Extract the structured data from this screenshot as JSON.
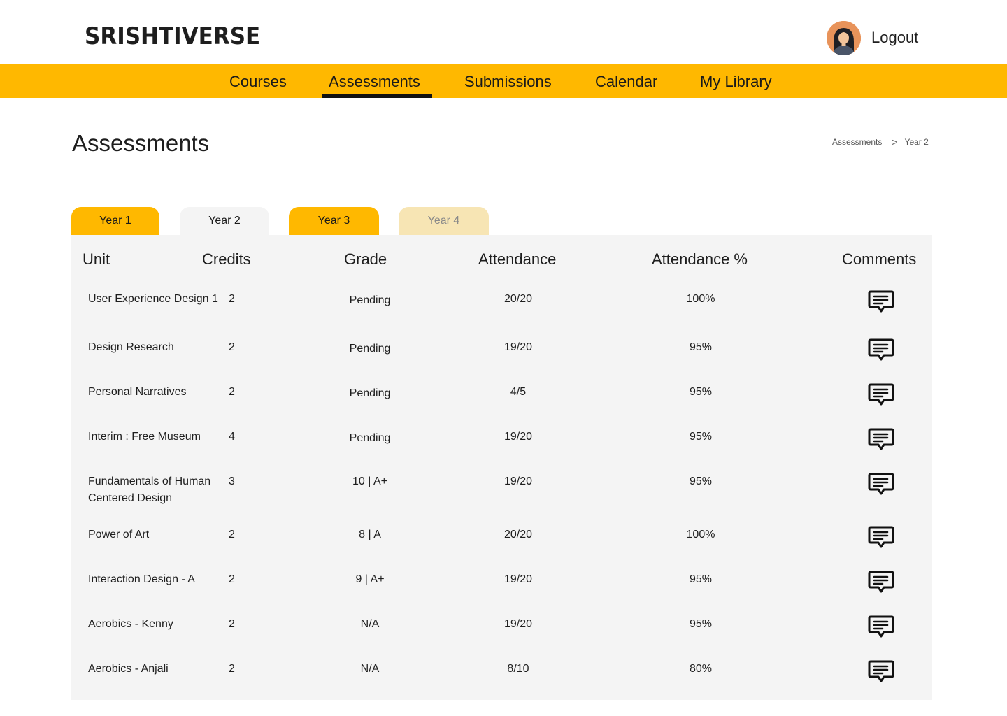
{
  "header": {
    "logo": "SRISHTIVERSE",
    "logout_label": "Logout"
  },
  "nav": {
    "items": [
      {
        "label": "Courses"
      },
      {
        "label": "Assessments"
      },
      {
        "label": "Submissions"
      },
      {
        "label": "Calendar"
      },
      {
        "label": "My Library"
      }
    ],
    "active": "Assessments"
  },
  "page": {
    "title": "Assessments",
    "breadcrumb": [
      "Assessments",
      "Year 2"
    ]
  },
  "tabs": [
    {
      "label": "Year 1"
    },
    {
      "label": "Year 2"
    },
    {
      "label": "Year 3"
    },
    {
      "label": "Year 4"
    }
  ],
  "active_tab": "Year 2",
  "table": {
    "columns": [
      "Unit",
      "Credits",
      "Grade",
      "Attendance",
      "Attendance %",
      "Comments"
    ],
    "rows": [
      {
        "unit": "User Experience Design 1",
        "credits": "2",
        "grade": "Pending",
        "attendance": "20/20",
        "percent": "100%"
      },
      {
        "unit": "Design Research",
        "credits": "2",
        "grade": "Pending",
        "attendance": "19/20",
        "percent": "95%"
      },
      {
        "unit": "Personal Narratives",
        "credits": "2",
        "grade": "Pending",
        "attendance": "4/5",
        "percent": "95%"
      },
      {
        "unit": "Interim : Free Museum",
        "credits": "4",
        "grade": "Pending",
        "attendance": "19/20",
        "percent": "95%"
      },
      {
        "unit": "Fundamentals of Human Centered Design",
        "credits": "3",
        "grade": "10 | A+",
        "attendance": "19/20",
        "percent": "95%"
      },
      {
        "unit": "Power of Art",
        "credits": "2",
        "grade": "8 | A",
        "attendance": "20/20",
        "percent": "100%"
      },
      {
        "unit": "Interaction Design - A",
        "credits": "2",
        "grade": "9 | A+",
        "attendance": "19/20",
        "percent": "95%"
      },
      {
        "unit": "Aerobics - Kenny",
        "credits": "2",
        "grade": "N/A",
        "attendance": "19/20",
        "percent": "95%"
      },
      {
        "unit": "Aerobics - Anjali",
        "credits": "2",
        "grade": "N/A",
        "attendance": "8/10",
        "percent": "80%"
      }
    ],
    "comment_icon": "comment-icon"
  },
  "colors": {
    "accent": "#ffb800",
    "accent_light": "#f7e5b4",
    "panel": "#f4f4f4",
    "text": "#1e1e1e"
  }
}
